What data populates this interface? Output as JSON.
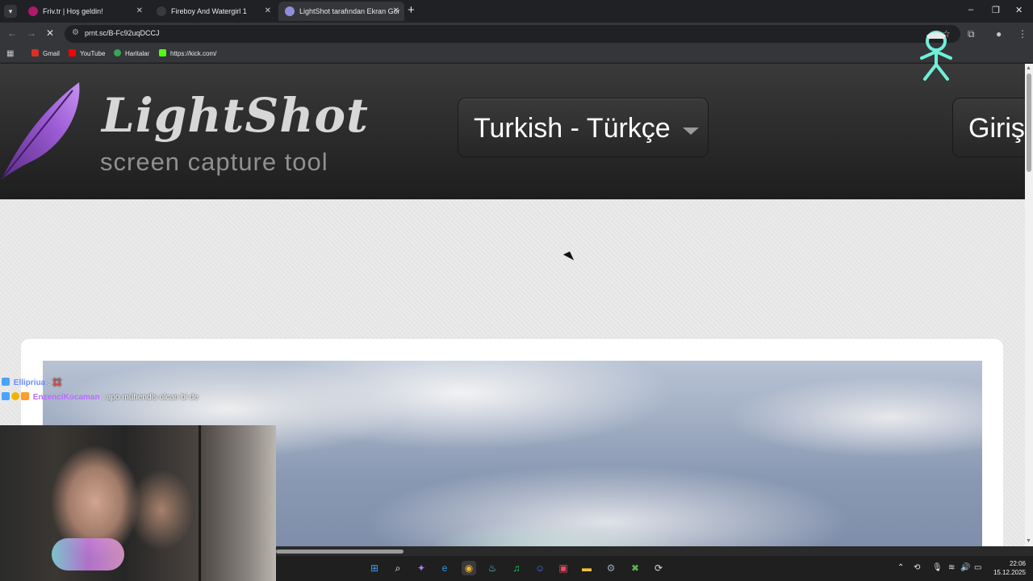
{
  "browser": {
    "tabs": [
      {
        "title": "Friv.tr | Hoş geldin!",
        "active": false,
        "favicon_color": "#b0186d"
      },
      {
        "title": "Fireboy And Watergirl 1",
        "active": false,
        "favicon_color": "#2a2a2a"
      },
      {
        "title": "LightShot tarafından Ekran Gör",
        "active": true,
        "favicon_color": "#8f8fd8"
      }
    ],
    "new_tab": "+",
    "window_controls": {
      "minimize": "–",
      "maximize": "❐",
      "close": "✕"
    },
    "address": "prnt.sc/B-Fc92uqDCCJ",
    "bookmarks": [
      {
        "label": "Gmail",
        "color": "#d93025"
      },
      {
        "label": "YouTube",
        "color": "#ff0000"
      },
      {
        "label": "Haritalar",
        "color": "#34a853"
      },
      {
        "label": "https://kick.com/",
        "color": "#53fc18"
      }
    ]
  },
  "site": {
    "logo_title": "LightShot",
    "logo_subtitle": "screen capture tool",
    "language_selected": "Turkish - Türkçe",
    "login_label": "Giriş"
  },
  "stream": {
    "chat": [
      {
        "user": "Ellipriua",
        "user_color": "#6a8cff",
        "message": " : 💢"
      },
      {
        "user": "EnzenciKocaman",
        "user_color": "#b96bff",
        "message": " : apo mühendis olcan bi de"
      }
    ]
  },
  "taskbar": {
    "apps": [
      {
        "name": "windows-start",
        "glyph": "⊞",
        "color": "#3aa0ff"
      },
      {
        "name": "search",
        "glyph": "⌕",
        "color": "#e8e8e8"
      },
      {
        "name": "copilot",
        "glyph": "✦",
        "color": "#b07cff"
      },
      {
        "name": "edge",
        "glyph": "e",
        "color": "#1fa0e3"
      },
      {
        "name": "chrome",
        "glyph": "◉",
        "color": "#f2b12b"
      },
      {
        "name": "steam",
        "glyph": "♨",
        "color": "#66c0f4"
      },
      {
        "name": "spotify",
        "glyph": "♫",
        "color": "#1ed760"
      },
      {
        "name": "discord",
        "glyph": "☺",
        "color": "#5865f2"
      },
      {
        "name": "photos",
        "glyph": "▣",
        "color": "#e84a5f"
      },
      {
        "name": "file-explorer",
        "glyph": "▬",
        "color": "#f5c042"
      },
      {
        "name": "settings",
        "glyph": "⚙",
        "color": "#9aa8b8"
      },
      {
        "name": "xbox",
        "glyph": "✖",
        "color": "#58b947"
      },
      {
        "name": "app",
        "glyph": "⟳",
        "color": "#dddddd"
      }
    ],
    "time": "22:06",
    "date": "15.12.2025"
  }
}
